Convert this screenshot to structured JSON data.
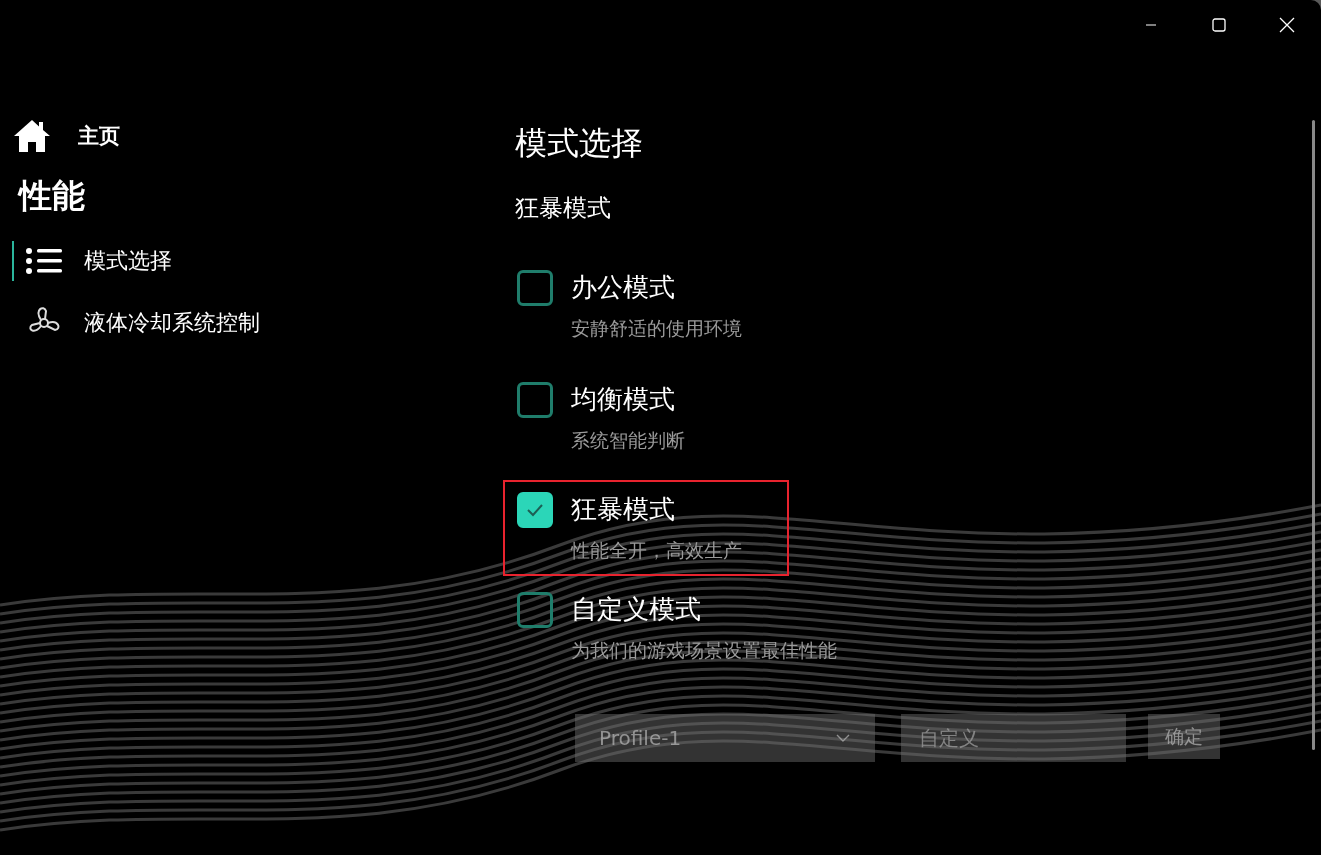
{
  "sidebar": {
    "home": {
      "label": "主页"
    },
    "section_title": "性能",
    "items": [
      {
        "label": "模式选择",
        "selected": true
      },
      {
        "label": "液体冷却系统控制",
        "selected": false
      }
    ]
  },
  "page_title": "模式选择",
  "current_mode": "狂暴模式",
  "modes": [
    {
      "title": "办公模式",
      "description": "安静舒适的使用环境",
      "checked": false,
      "highlighted": false
    },
    {
      "title": "均衡模式",
      "description": "系统智能判断",
      "checked": false,
      "highlighted": false
    },
    {
      "title": "狂暴模式",
      "description": "性能全开，高效生产",
      "checked": true,
      "highlighted": true
    },
    {
      "title": "自定义模式",
      "description": "为我们的游戏场景设置最佳性能",
      "checked": false,
      "highlighted": false
    }
  ],
  "custom": {
    "profile": "Profile-1",
    "name_placeholder": "自定义",
    "confirm": "确定",
    "disabled": true
  }
}
